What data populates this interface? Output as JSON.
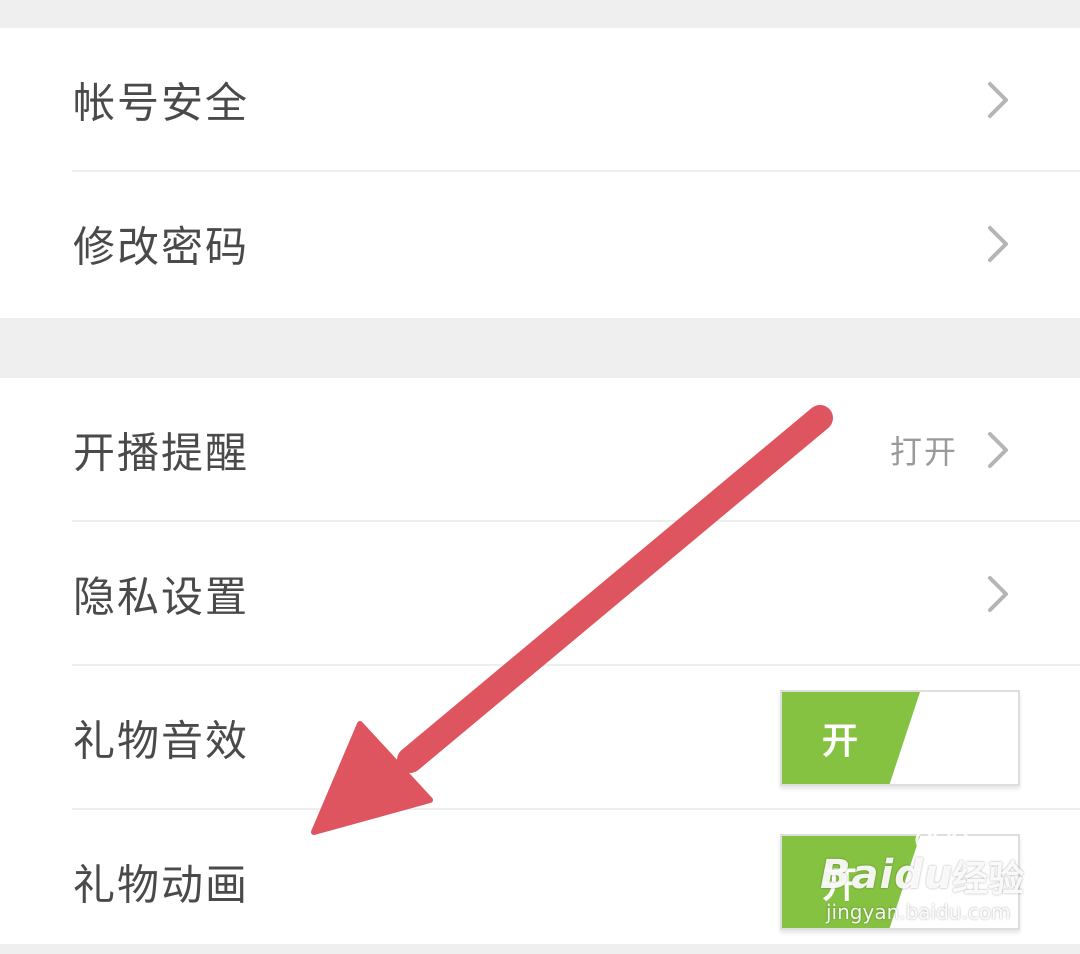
{
  "settings": {
    "group1": [
      {
        "label": "帐号安全"
      },
      {
        "label": "修改密码"
      }
    ],
    "group2": {
      "live_reminder": {
        "label": "开播提醒",
        "value": "打开"
      },
      "privacy": {
        "label": "隐私设置"
      },
      "gift_sound": {
        "label": "礼物音效",
        "toggle_label": "开",
        "on": true
      },
      "gift_animation": {
        "label": "礼物动画",
        "toggle_label": "开",
        "on": true
      }
    }
  },
  "icons": {
    "chevron": "chevron-right-icon"
  },
  "annotation": {
    "arrow_color": "#de5560"
  },
  "watermark": {
    "logo": "Baidu",
    "logo_cn": "经验",
    "url": "jingyan.baidu.com"
  },
  "colors": {
    "toggle_on": "#86c242",
    "text": "#4a4a4a",
    "secondary_text": "#9a9a9a",
    "background": "#efefef"
  }
}
